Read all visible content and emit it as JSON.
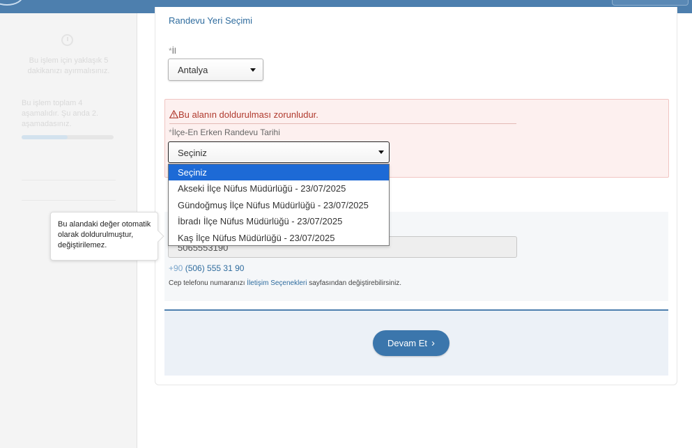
{
  "sidebar": {
    "time_text": "Bu işlem için yaklaşık 5 dakikanızı ayırmalısınız.",
    "step_text": "Bu işlem toplam 4 aşamalıdır. Şu anda 2. aşamadasınız.",
    "progress_fraction": 0.5
  },
  "form": {
    "section_title": "Randevu Yeri Seçimi",
    "il": {
      "required_mark": "*",
      "label": "İl",
      "value": "Antalya"
    },
    "error_message": "Bu alanın doldurulması zorunludur.",
    "ilce": {
      "required_mark": "*",
      "label": "İlçe-En Erken Randevu Tarihi",
      "value": "Seçiniz",
      "options": [
        "Seçiniz",
        "Akseki İlçe Nüfus Müdürlüğü - 23/07/2025",
        "Gündoğmuş İlçe Nüfus Müdürlüğü - 23/07/2025",
        "İbradı İlçe Nüfus Müdürlüğü - 23/07/2025",
        "Kaş İlçe Nüfus Müdürlüğü - 23/07/2025"
      ],
      "selected_index": 0
    },
    "phone": {
      "input_value": "5065553190",
      "country_code": "+90",
      "formatted": "(506) 555 31 90",
      "note_before": "Cep telefonu numaranızı ",
      "note_link": "İletişim Seçenekleri",
      "note_after": " sayfasından değiştirebilirsiniz."
    },
    "tooltip": "Bu alandaki değer otomatik olarak doldurulmuştur, değiştirilemez.",
    "continue_label": "Devam Et",
    "continue_chevron": "›",
    "error_icon": "warning-triangle-icon"
  },
  "colors": {
    "header": "#4d7fae",
    "link": "#2f6c9e",
    "error": "#b03a2e",
    "error_bg": "#fdf0ef",
    "button": "#3b76ac",
    "option_highlight": "#1d6ad6"
  }
}
